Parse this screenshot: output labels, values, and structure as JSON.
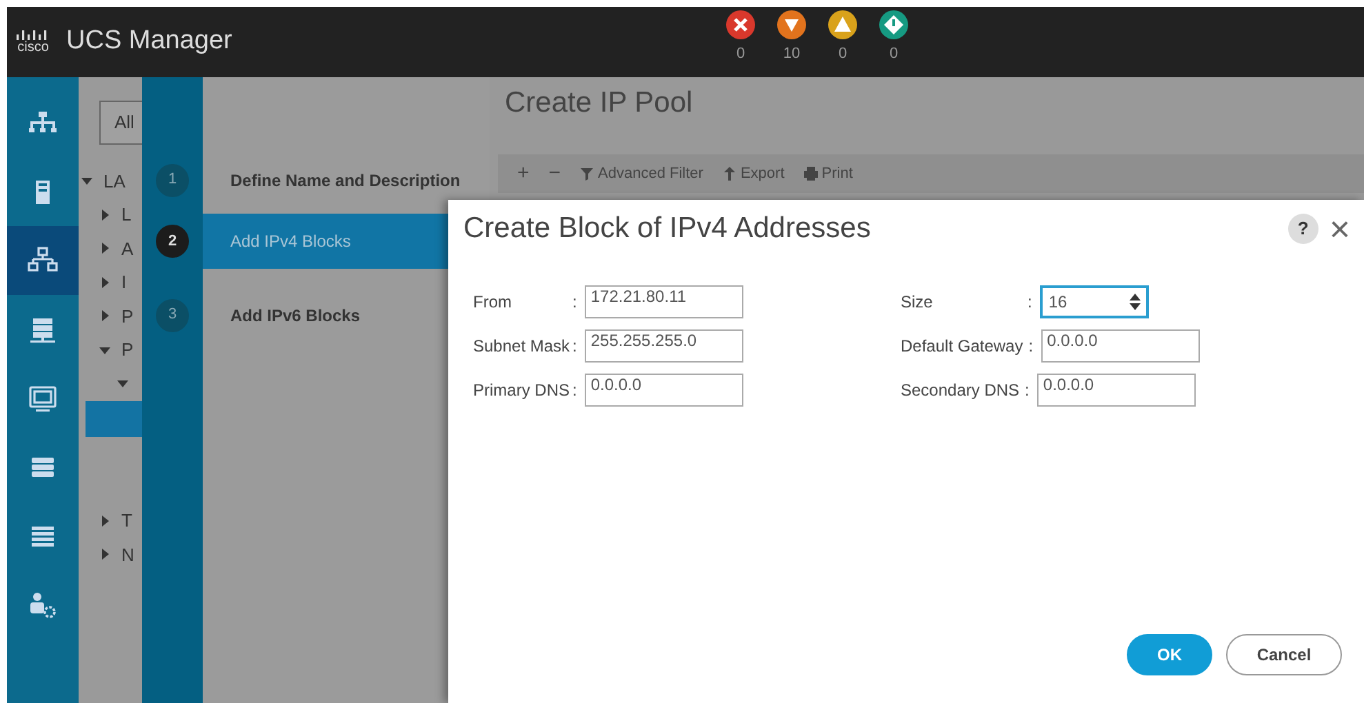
{
  "app": {
    "logo": "cisco",
    "title": "UCS Manager"
  },
  "fault_summary": [
    {
      "kind": "critical",
      "count": "0",
      "color": "#d9382c"
    },
    {
      "kind": "major",
      "count": "10",
      "color": "#e2731d"
    },
    {
      "kind": "minor",
      "count": "0",
      "color": "#d9a21b"
    },
    {
      "kind": "warning",
      "count": "0",
      "color": "#169a82"
    }
  ],
  "nav_rail": [
    {
      "kind": "equipment",
      "selected": false
    },
    {
      "kind": "servers",
      "selected": false
    },
    {
      "kind": "lan",
      "selected": true
    },
    {
      "kind": "san",
      "selected": false
    },
    {
      "kind": "vm",
      "selected": false
    },
    {
      "kind": "storage",
      "selected": false
    },
    {
      "kind": "chassis",
      "selected": false
    },
    {
      "kind": "admin",
      "selected": false
    }
  ],
  "tree": {
    "filter": "All",
    "items": [
      {
        "label": "LA",
        "expanded": true,
        "children": [
          {
            "label": "L",
            "expanded": false
          },
          {
            "label": "A",
            "expanded": false
          },
          {
            "label": "I",
            "expanded": false
          },
          {
            "label": "P",
            "expanded": false
          },
          {
            "label": "P",
            "expanded": true,
            "children": [
              {
                "expanded": true,
                "children": [
                  {
                    "selected": true
                  },
                  {
                    "selected": false
                  },
                  {
                    "selected": false
                  }
                ]
              }
            ]
          },
          {
            "label": "T",
            "expanded": false
          },
          {
            "label": "N",
            "expanded": false
          }
        ]
      }
    ]
  },
  "main": {
    "title": "Create IP Pool",
    "toolbar": [
      {
        "kind": "add",
        "label": "+"
      },
      {
        "kind": "remove",
        "label": "−"
      },
      {
        "kind": "filter",
        "label": "Advanced Filter"
      },
      {
        "kind": "export",
        "label": "Export"
      },
      {
        "kind": "print",
        "label": "Print"
      }
    ]
  },
  "wizard": {
    "steps": [
      {
        "number": "1",
        "label": "Define Name and Description",
        "selected": false
      },
      {
        "number": "2",
        "label": "Add IPv4 Blocks",
        "selected": true
      },
      {
        "number": "3",
        "label": "Add IPv6 Blocks",
        "selected": false
      }
    ]
  },
  "dialog": {
    "title": "Create Block of IPv4 Addresses",
    "help": "?",
    "close": "×",
    "fields": [
      {
        "label": "From",
        "colon": ":",
        "value": "172.21.80.11",
        "kind": "text",
        "focused": false
      },
      {
        "label": "Size",
        "colon": ":",
        "value": "16",
        "kind": "spinner",
        "focused": true
      },
      {
        "label": "Subnet Mask",
        "colon": ":",
        "value": "255.255.255.0",
        "kind": "text",
        "focused": false
      },
      {
        "label": "Default Gateway",
        "colon": ":",
        "value": "0.0.0.0",
        "kind": "text",
        "focused": false
      },
      {
        "label": "Primary DNS",
        "colon": ":",
        "value": "0.0.0.0",
        "kind": "text",
        "focused": false
      },
      {
        "label": "Secondary DNS",
        "colon": ":",
        "value": "0.0.0.0",
        "kind": "text",
        "focused": false
      }
    ],
    "buttons": [
      {
        "label": "OK",
        "kind": "primary"
      },
      {
        "label": "Cancel",
        "kind": "secondary"
      }
    ]
  }
}
